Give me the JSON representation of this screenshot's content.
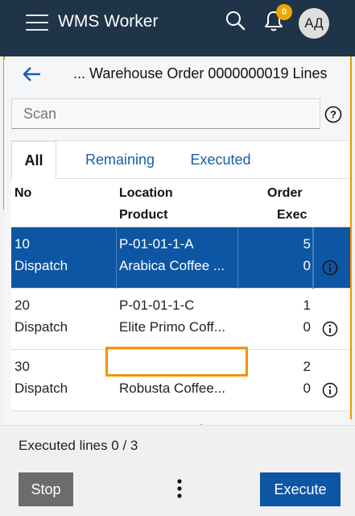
{
  "app": {
    "title": "WMS Worker",
    "notification_count": "0",
    "user_initials": "АД",
    "accent_color": "#0d56a3",
    "header_color": "#1f3448",
    "highlight_color": "#f29300"
  },
  "header": {
    "title": "... Warehouse Order 0000000019 Lines",
    "back_icon": "arrow-left-icon"
  },
  "scan": {
    "placeholder": "Scan",
    "value": ""
  },
  "tabs": [
    {
      "label": "All",
      "active": true
    },
    {
      "label": "Remaining",
      "active": false
    },
    {
      "label": "Executed",
      "active": false
    }
  ],
  "table": {
    "columns": {
      "no": "No",
      "location": "Location",
      "product": "Product",
      "order": "Order",
      "exec": "Exec"
    },
    "rows": [
      {
        "no": "10",
        "type": "Dispatch",
        "location": "P-01-01-1-A",
        "product": "Arabica Coffee ...",
        "order": "5",
        "exec": "0",
        "selected": true
      },
      {
        "no": "20",
        "type": "Dispatch",
        "location": "P-01-01-1-C",
        "product": "Elite Primo Coff...",
        "order": "1",
        "exec": "0",
        "selected": false
      },
      {
        "no": "30",
        "type": "Dispatch",
        "location": "",
        "product": "Robusta Coffee...",
        "order": "2",
        "exec": "0",
        "selected": false
      }
    ]
  },
  "footer": {
    "status": "Executed lines 0 / 3",
    "stop_label": "Stop",
    "execute_label": "Execute"
  }
}
